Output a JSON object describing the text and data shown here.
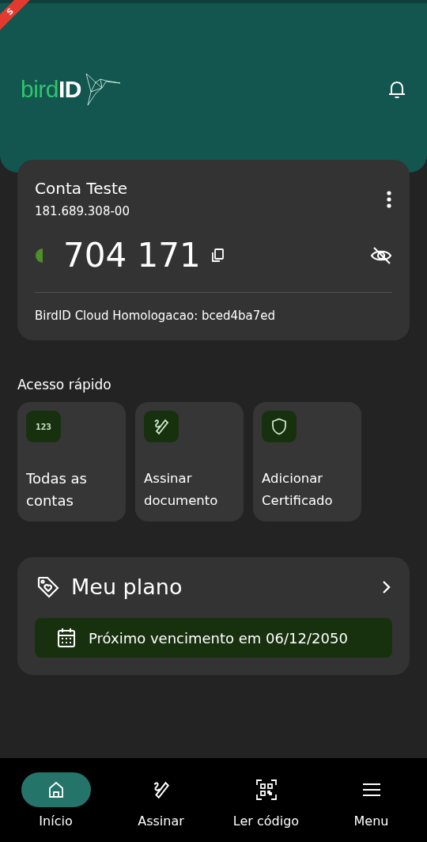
{
  "debug_banner": {
    "text": "S"
  },
  "header": {
    "logo": {
      "part1": "bird",
      "part2": "ID"
    }
  },
  "account": {
    "name": "Conta Teste",
    "document": "181.689.308-00",
    "code": "704 171",
    "service": "BirdID Cloud Homologacao: bced4ba7ed"
  },
  "quick_access": {
    "title": "Acesso rápido",
    "items": [
      {
        "kind": "numbers",
        "glyph": "123",
        "label": "Todas as contas"
      },
      {
        "kind": "sign",
        "label": "Assinar documento"
      },
      {
        "kind": "shield",
        "label": "Adicionar Certificado"
      }
    ]
  },
  "plan": {
    "title": "Meu plano",
    "due": "Próximo vencimento em 06/12/2050"
  },
  "nav": [
    {
      "kind": "home",
      "label": "Início",
      "selected": true
    },
    {
      "kind": "sign",
      "label": "Assinar",
      "selected": false
    },
    {
      "kind": "qr",
      "label": "Ler código",
      "selected": false
    },
    {
      "kind": "menu",
      "label": "Menu",
      "selected": false
    }
  ]
}
